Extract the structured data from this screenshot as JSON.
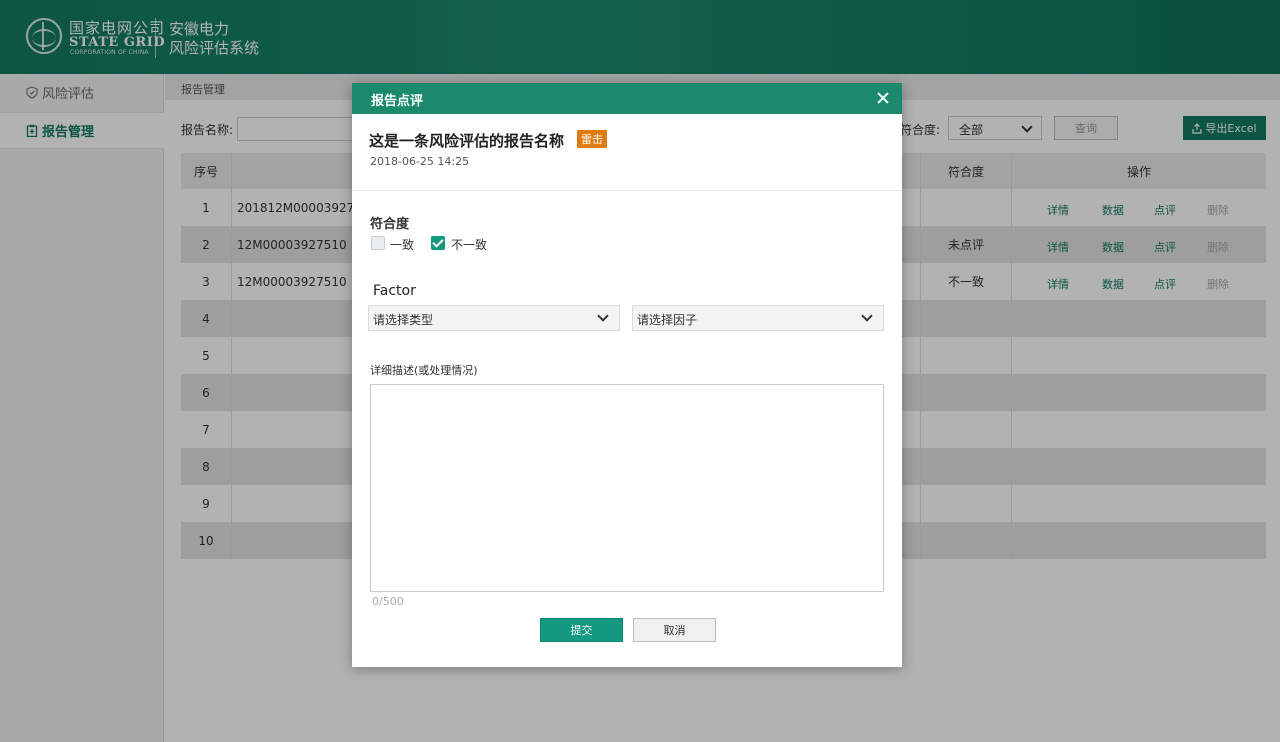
{
  "header": {
    "company_cn": "国家电网公司",
    "company_en": "STATE GRID",
    "company_en_sub": "CORPORATION OF CHINA",
    "app_title_line1": "安徽电力",
    "app_title_line2": "风险评估系统"
  },
  "sidebar": {
    "items": [
      {
        "label": "风险评估",
        "icon": "shield-icon"
      },
      {
        "label": "报告管理",
        "icon": "report-icon"
      }
    ]
  },
  "breadcrumb": "报告管理",
  "filters": {
    "report_name_label": "报告名称:",
    "conformity_label": "符合度:",
    "conformity_value": "全部",
    "query_button": "查询",
    "export_button": "导出Excel"
  },
  "table": {
    "headers": [
      "序号",
      "符合度",
      "操作"
    ],
    "rows": [
      {
        "index": "1",
        "code": "201812M00003927",
        "conformity": ""
      },
      {
        "index": "2",
        "code": "12M00003927510",
        "conformity": "未点评"
      },
      {
        "index": "3",
        "code": "12M00003927510",
        "conformity": "不一致"
      },
      {
        "index": "4"
      },
      {
        "index": "5"
      },
      {
        "index": "6"
      },
      {
        "index": "7"
      },
      {
        "index": "8"
      },
      {
        "index": "9"
      },
      {
        "index": "10"
      }
    ],
    "ops": [
      "详情",
      "数据",
      "点评",
      "删除"
    ]
  },
  "modal": {
    "title": "报告点评",
    "report_name": "这是一条风险评估的报告名称",
    "report_tag": "雷击",
    "report_date": "2018-06-25 14:25",
    "conformity_label": "符合度",
    "options": [
      {
        "label": "一致",
        "checked": false
      },
      {
        "label": "不一致",
        "checked": true
      }
    ],
    "factor_label": "Factor",
    "type_select": "请选择类型",
    "factor_select": "请选择因子",
    "desc_label": "详细描述(或处理情况)",
    "desc_value": "",
    "counter": "0/500",
    "submit": "提交",
    "cancel": "取消"
  },
  "colors": {
    "brand": "#127a5f",
    "accent": "#12997f",
    "tag": "#e07b14"
  }
}
